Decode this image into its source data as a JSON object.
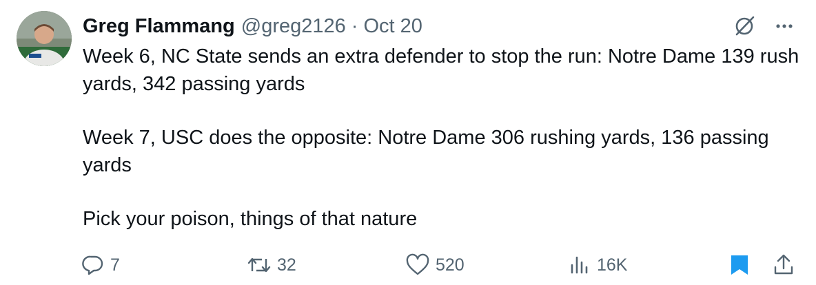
{
  "tweet": {
    "author_name": "Greg Flammang",
    "handle": "@greg2126",
    "separator": "·",
    "date": "Oct 20",
    "paragraphs": [
      "Week 6, NC State sends an extra defender to stop the run: Notre Dame 139 rush yards, 342 passing yards",
      "Week 7, USC does the opposite: Notre Dame 306 rushing yards, 136 passing yards",
      "Pick your poison, things of that nature"
    ]
  },
  "actions": {
    "replies": "7",
    "retweets": "32",
    "likes": "520",
    "views": "16K"
  },
  "icons": {
    "top": [
      "grok-icon",
      "more-icon"
    ],
    "actions": [
      "reply-icon",
      "retweet-icon",
      "like-icon",
      "views-icon",
      "bookmark-icon",
      "share-icon"
    ]
  },
  "colors": {
    "text": "#0f1419",
    "secondary": "#536471",
    "bookmark_active": "#1d9bf0"
  }
}
